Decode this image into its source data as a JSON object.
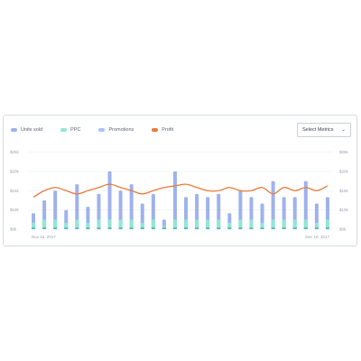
{
  "legend": [
    {
      "label": "Units sold",
      "color": "#9fb2ee"
    },
    {
      "label": "PPC",
      "color": "#92e6d4"
    },
    {
      "label": "Promotions",
      "color": "#a7c5f4"
    },
    {
      "label": "Profit",
      "color": "#e87a3a"
    }
  ],
  "controls": {
    "select_label": "Select Metrics"
  },
  "chart_data": {
    "type": "bar",
    "x_start_label": "Nov 16, 2017",
    "x_end_label": "Dec 16, 2017",
    "y_ticks_left": [
      "$0k",
      "$10k",
      "$15k",
      "$20k",
      "$25k"
    ],
    "y_ticks_right": [
      "$0k",
      "$10k",
      "$15k",
      "$20k",
      "$25k"
    ],
    "ylim": [
      0,
      25
    ],
    "grid": true,
    "legend_position": "top-left",
    "series": [
      {
        "name": "Units sold",
        "type": "bar",
        "color": "#9fb2ee",
        "values": [
          5,
          9,
          12,
          6,
          14,
          7,
          11,
          18,
          12,
          14,
          8,
          11,
          3,
          18,
          10,
          11,
          10,
          11,
          5,
          12,
          10,
          8,
          15,
          10,
          10,
          15,
          8,
          10
        ]
      },
      {
        "name": "PPC",
        "type": "bar",
        "color": "#92e6d4",
        "values": [
          2,
          3,
          3,
          2,
          3,
          2,
          3,
          3,
          3,
          3,
          2,
          3,
          1,
          3,
          3,
          3,
          3,
          3,
          2,
          3,
          3,
          2,
          3,
          3,
          3,
          3,
          2,
          3
        ]
      },
      {
        "name": "Profit",
        "type": "line",
        "color": "#e87a3a",
        "values": [
          10,
          12,
          13,
          12,
          11,
          12,
          13,
          14,
          13,
          12,
          11,
          12,
          13,
          13.5,
          14,
          13,
          12,
          12,
          13,
          12,
          12,
          13,
          11,
          13,
          12,
          13,
          12,
          13.5
        ]
      }
    ]
  }
}
